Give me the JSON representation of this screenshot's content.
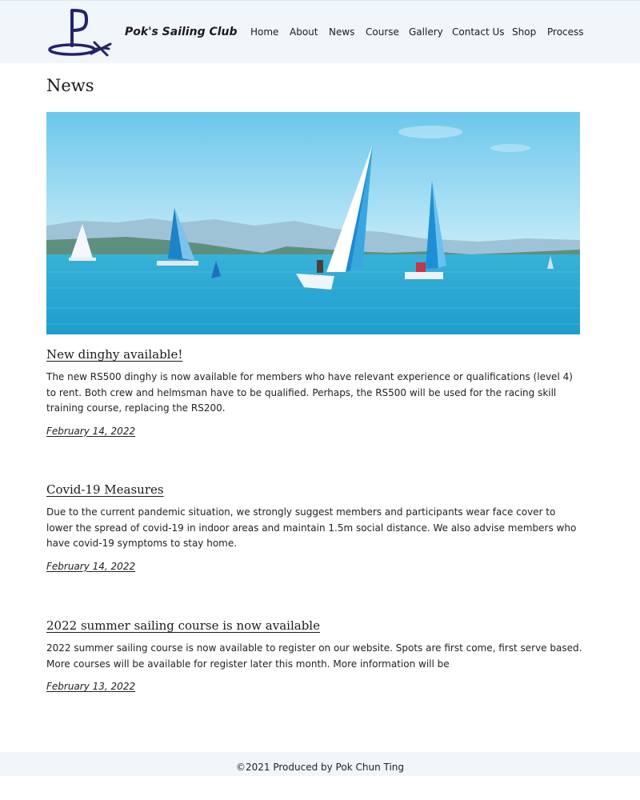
{
  "header": {
    "brand": "Pok's Sailing Club",
    "nav": [
      {
        "label": "Home"
      },
      {
        "label": "About"
      },
      {
        "label": "News"
      },
      {
        "label": "Course"
      },
      {
        "label": "Gallery"
      },
      {
        "label": "Contact Us"
      },
      {
        "label": "Shop"
      },
      {
        "label": "Process"
      }
    ]
  },
  "main": {
    "title": "News",
    "articles": [
      {
        "heading": "New dinghy available!",
        "body": "The new RS500 dinghy is now available for members who have relevant experience or qualifications (level 4) to rent. Both crew and helmsman have to be qualified. Perhaps, the RS500 will be used for the racing skill training course, replacing the RS200.",
        "date": "February 14, 2022"
      },
      {
        "heading": "Covid-19 Measures",
        "body": "Due to the current pandemic situation, we strongly suggest members and participants wear face cover to lower the spread of covid-19 in indoor areas and maintain 1.5m social distance. We also advise members who have covid-19 symptoms to stay home.",
        "date": "February 14, 2022"
      },
      {
        "heading": "2022 summer sailing course is now available",
        "body": "2022 summer sailing course is now available to register on our website. Spots are first come, first serve based. More courses will be available for register later this month. More information will be",
        "date": "February 13, 2022"
      }
    ]
  },
  "footer": {
    "text": "©2021 Produced by Pok Chun Ting"
  },
  "colors": {
    "header_bg": "#f1f6fb",
    "logo_navy": "#23236b",
    "text": "#1a1a1a"
  }
}
